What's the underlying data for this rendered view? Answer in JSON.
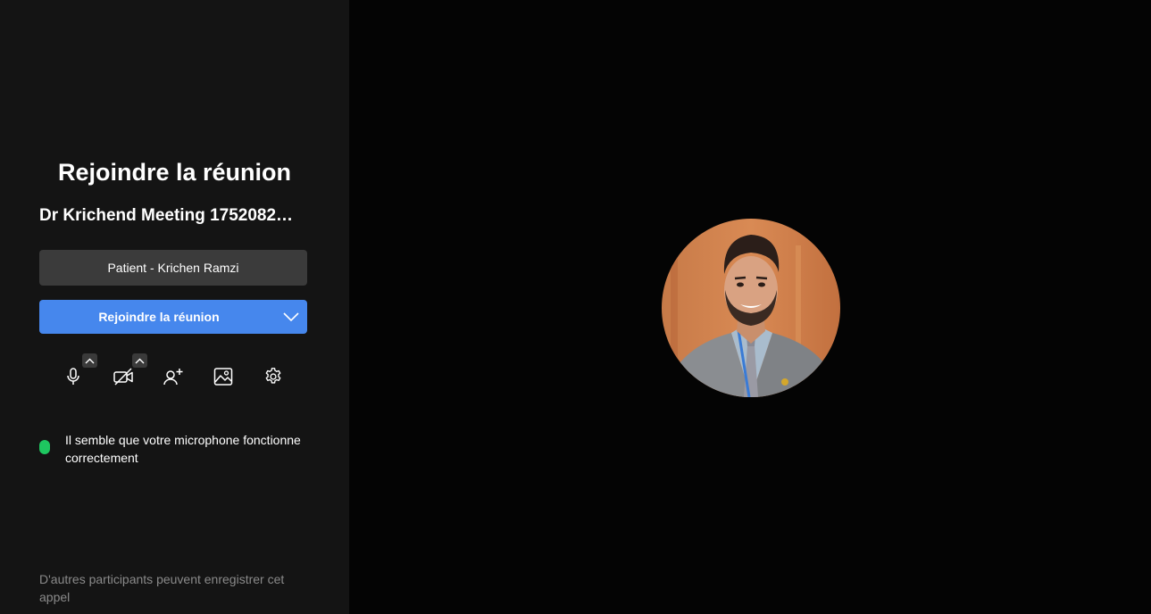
{
  "prejoin": {
    "title": "Rejoindre la réunion",
    "meeting_name": "Dr Krichend Meeting 1752082…",
    "name_field_value": "Patient - Krichen Ramzi",
    "join_button_label": "Rejoindre la réunion",
    "mic_status_text": "Il semble que votre microphone fonctionne correctement",
    "recording_notice": "D'autres participants peuvent enregistrer cet appel"
  },
  "toolbar": {
    "icons": [
      "microphone-icon",
      "video-off-icon",
      "invite-person-icon",
      "background-image-icon",
      "settings-gear-icon"
    ]
  },
  "colors": {
    "left_panel_bg": "#141414",
    "main_bg": "#040404",
    "accent_blue": "#4687ed",
    "input_bg": "#3b3b3b",
    "status_green": "#1ec760"
  }
}
